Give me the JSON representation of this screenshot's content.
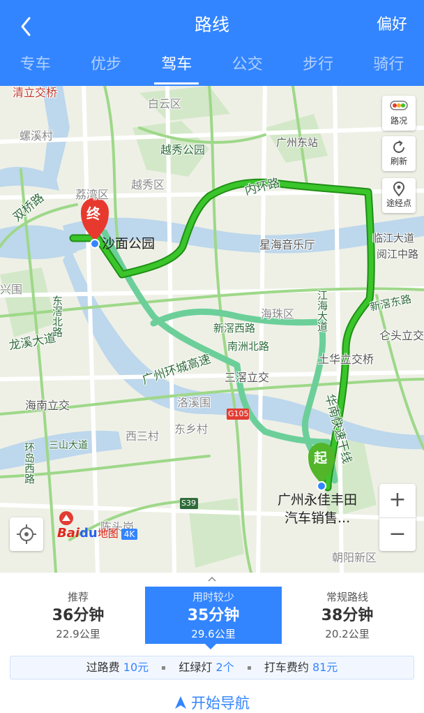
{
  "header": {
    "title": "路线",
    "preference_label": "偏好",
    "tabs": [
      {
        "label": "专车",
        "active": false
      },
      {
        "label": "优步",
        "active": false
      },
      {
        "label": "驾车",
        "active": true
      },
      {
        "label": "公交",
        "active": false
      },
      {
        "label": "步行",
        "active": false
      },
      {
        "label": "骑行",
        "active": false
      }
    ]
  },
  "map": {
    "labels": {
      "baiyun": "白云区",
      "yuexiu_park": "越秀公园",
      "guangzhou_east": "广州东站",
      "yuexiu_district": "越秀区",
      "liwan": "荔湾区",
      "inner_ring": "内环路",
      "shamian": "沙面公园",
      "xinghai": "星海音乐厅",
      "linjiang": "临江大道",
      "yuejiang": "阅江中路",
      "haizhu": "海珠区",
      "xinjiao_west": "新滘西路",
      "xinjiao_east": "新滘东路",
      "nanzhou": "南洲北路",
      "jianghai": "江海大道",
      "canglu": "仑头立交",
      "tuhua": "土华立交桥",
      "sanxi": "三滘立交",
      "ring_expressway": "广州环城高速",
      "luoxi": "洛溪围",
      "dongxiang": "东乡村",
      "sanxi_village": "西三村",
      "g105": "G105",
      "huanan_express": "华南快速干线",
      "s39": "S39",
      "chentougang": "陈头岗",
      "chaoyang": "朝阳新区",
      "haiNan": "海南立交",
      "longxi": "龙溪大道",
      "dongjiao": "东滘北路",
      "huandao": "环岛西路",
      "sanshan": "三山大道",
      "shuangqiao": "双桥路",
      "luoxi_village": "螺溪村",
      "qingli": "清立交桥",
      "xingwei": "兴围",
      "start_poi": "广州永佳丰田\n汽车销售...",
      "start_poi_line1": "广州永佳丰田",
      "start_poi_line2": "汽车销售...",
      "end_marker": "终",
      "start_marker": "起"
    },
    "tools": {
      "traffic": "路况",
      "refresh": "刷新",
      "waypoint": "途经点"
    },
    "zoom_in": "+",
    "zoom_out": "−",
    "logo": {
      "bai": "Bai",
      "du": "du",
      "ditu": "地图",
      "badge": "4K"
    }
  },
  "routes": [
    {
      "tag": "推荐",
      "time": "36分钟",
      "distance": "22.9公里",
      "selected": false
    },
    {
      "tag": "用时较少",
      "time": "35分钟",
      "distance": "29.6公里",
      "selected": true
    },
    {
      "tag": "常规路线",
      "time": "38分钟",
      "distance": "20.2公里",
      "selected": false
    }
  ],
  "info": {
    "toll_label": "过路费",
    "toll_value": "10元",
    "lights_label": "红绿灯",
    "lights_value": "2个",
    "taxi_label": "打车费约",
    "taxi_value": "81元"
  },
  "start_navigation": "开始导航",
  "colors": {
    "brand": "#3385ff",
    "route_primary": "#2bb31a",
    "route_alt": "#6ccf9a"
  }
}
